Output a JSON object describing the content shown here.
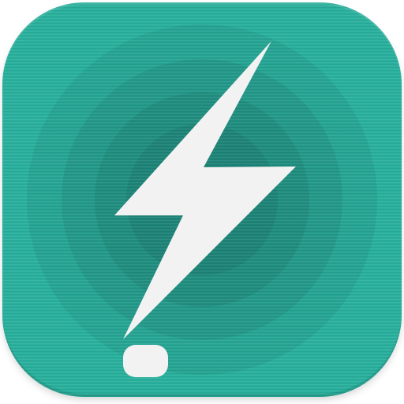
{
  "app_icon": {
    "icon_name": "lightning-bolt-alert-icon",
    "colors": {
      "tile": "#2ab09d",
      "ring_1": "#27a594",
      "ring_2": "#24998a",
      "ring_3": "#218e80",
      "ring_4": "#1f8478",
      "glyph": "#f2f2f2"
    }
  }
}
